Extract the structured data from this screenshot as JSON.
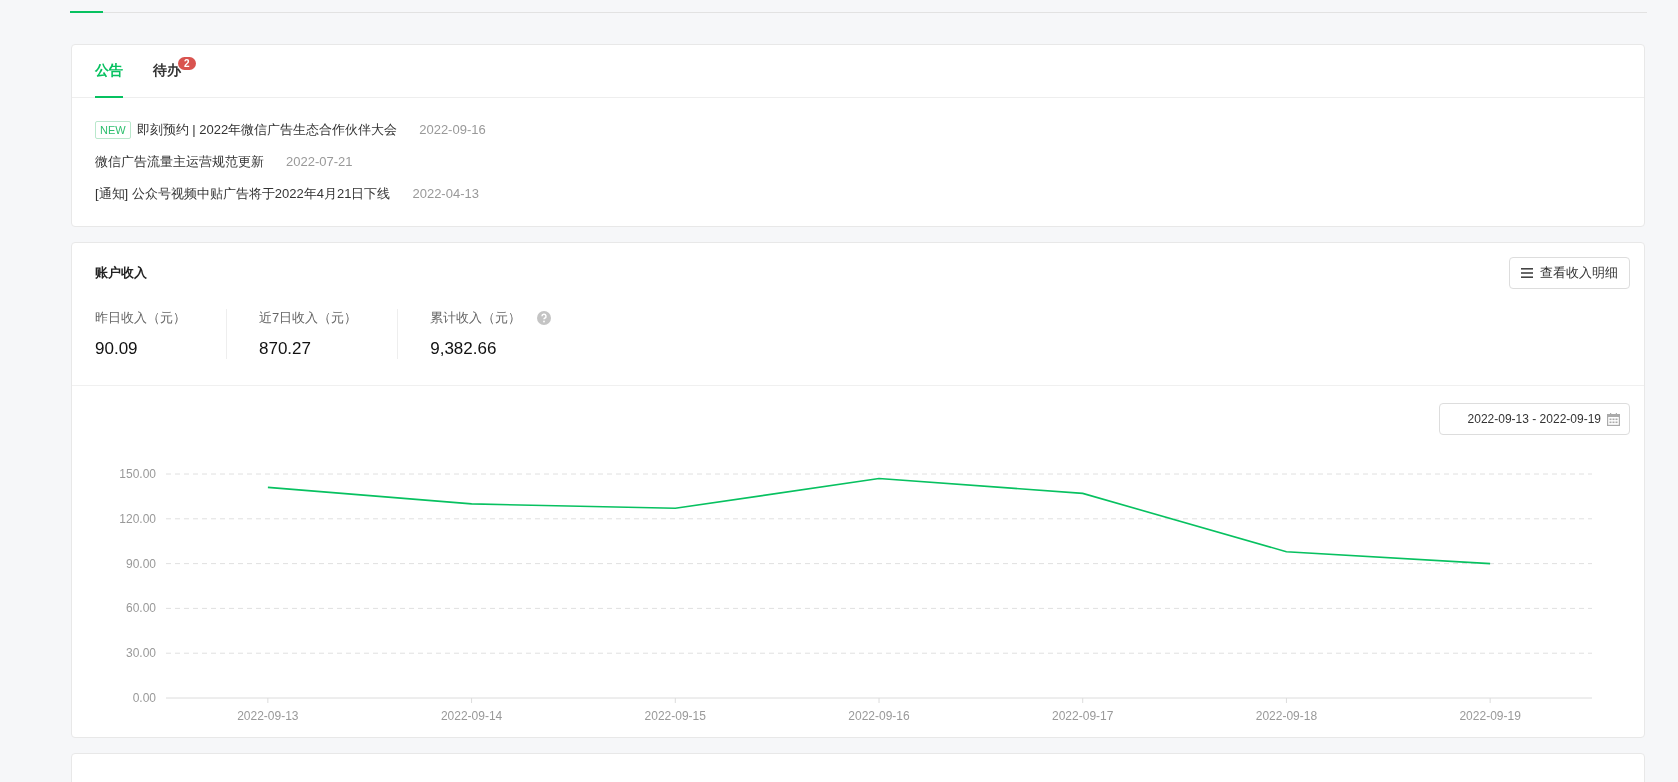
{
  "announcement_tabs": [
    {
      "label": "公告",
      "selected": true
    },
    {
      "label": "待办",
      "selected": false,
      "badge": "2"
    }
  ],
  "announcements": [
    {
      "tag": "NEW",
      "title": "即刻预约 | 2022年微信广告生态合作伙伴大会",
      "date": "2022-09-16"
    },
    {
      "title": "微信广告流量主运营规范更新",
      "date": "2022-07-21"
    },
    {
      "title": "[通知] 公众号视频中贴广告将于2022年4月21日下线",
      "date": "2022-04-13"
    }
  ],
  "income": {
    "title": "账户收入",
    "detail_button": "查看收入明细",
    "stats": [
      {
        "label": "昨日收入（元）",
        "value": "90.09",
        "help": false
      },
      {
        "label": "近7日收入（元）",
        "value": "870.27",
        "help": false
      },
      {
        "label": "累计收入（元）",
        "value": "9,382.66",
        "help": true
      }
    ],
    "date_range": "2022-09-13 - 2022-09-19",
    "chart_data": {
      "type": "line",
      "categories": [
        "2022-09-13",
        "2022-09-14",
        "2022-09-15",
        "2022-09-16",
        "2022-09-17",
        "2022-09-18",
        "2022-09-19"
      ],
      "series": [
        {
          "color": "#07c160",
          "values": [
            141,
            130,
            127,
            147,
            137,
            98,
            90
          ]
        }
      ],
      "grid": true,
      "ylim": [
        0,
        150
      ],
      "yticks": [
        {
          "value": 0,
          "label": "0.00"
        },
        {
          "value": 30,
          "label": "30.00"
        },
        {
          "value": 60,
          "label": "60.00"
        },
        {
          "value": 90,
          "label": "90.00"
        },
        {
          "value": 120,
          "label": "120.00"
        },
        {
          "value": 150,
          "label": "150.00"
        }
      ]
    }
  }
}
